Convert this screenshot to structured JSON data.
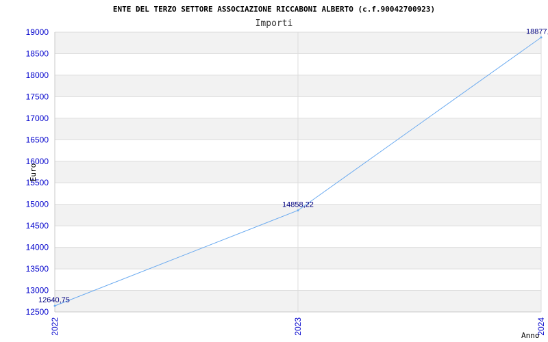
{
  "chart_data": {
    "type": "line",
    "title": "ENTE DEL TERZO SETTORE ASSOCIAZIONE RICCABONI ALBERTO (c.f.90042700923)",
    "subtitle": "Importi",
    "xlabel": "Anno",
    "ylabel": "Euro",
    "categories": [
      "2022",
      "2023",
      "2024"
    ],
    "series": [
      {
        "values": [
          12640.75,
          14858.22,
          18877.0
        ],
        "value_labels": [
          "12640,75",
          "14858,22",
          "18877,"
        ],
        "color": "#6aaaf0"
      }
    ],
    "ylim": [
      12500,
      19000
    ],
    "yticks": [
      12500,
      13000,
      13500,
      14000,
      14500,
      15000,
      15500,
      16000,
      16500,
      17000,
      17500,
      18000,
      18500,
      19000
    ],
    "grid": true,
    "band_color": "#f2f2f2",
    "tick_color": "#0000cc"
  }
}
